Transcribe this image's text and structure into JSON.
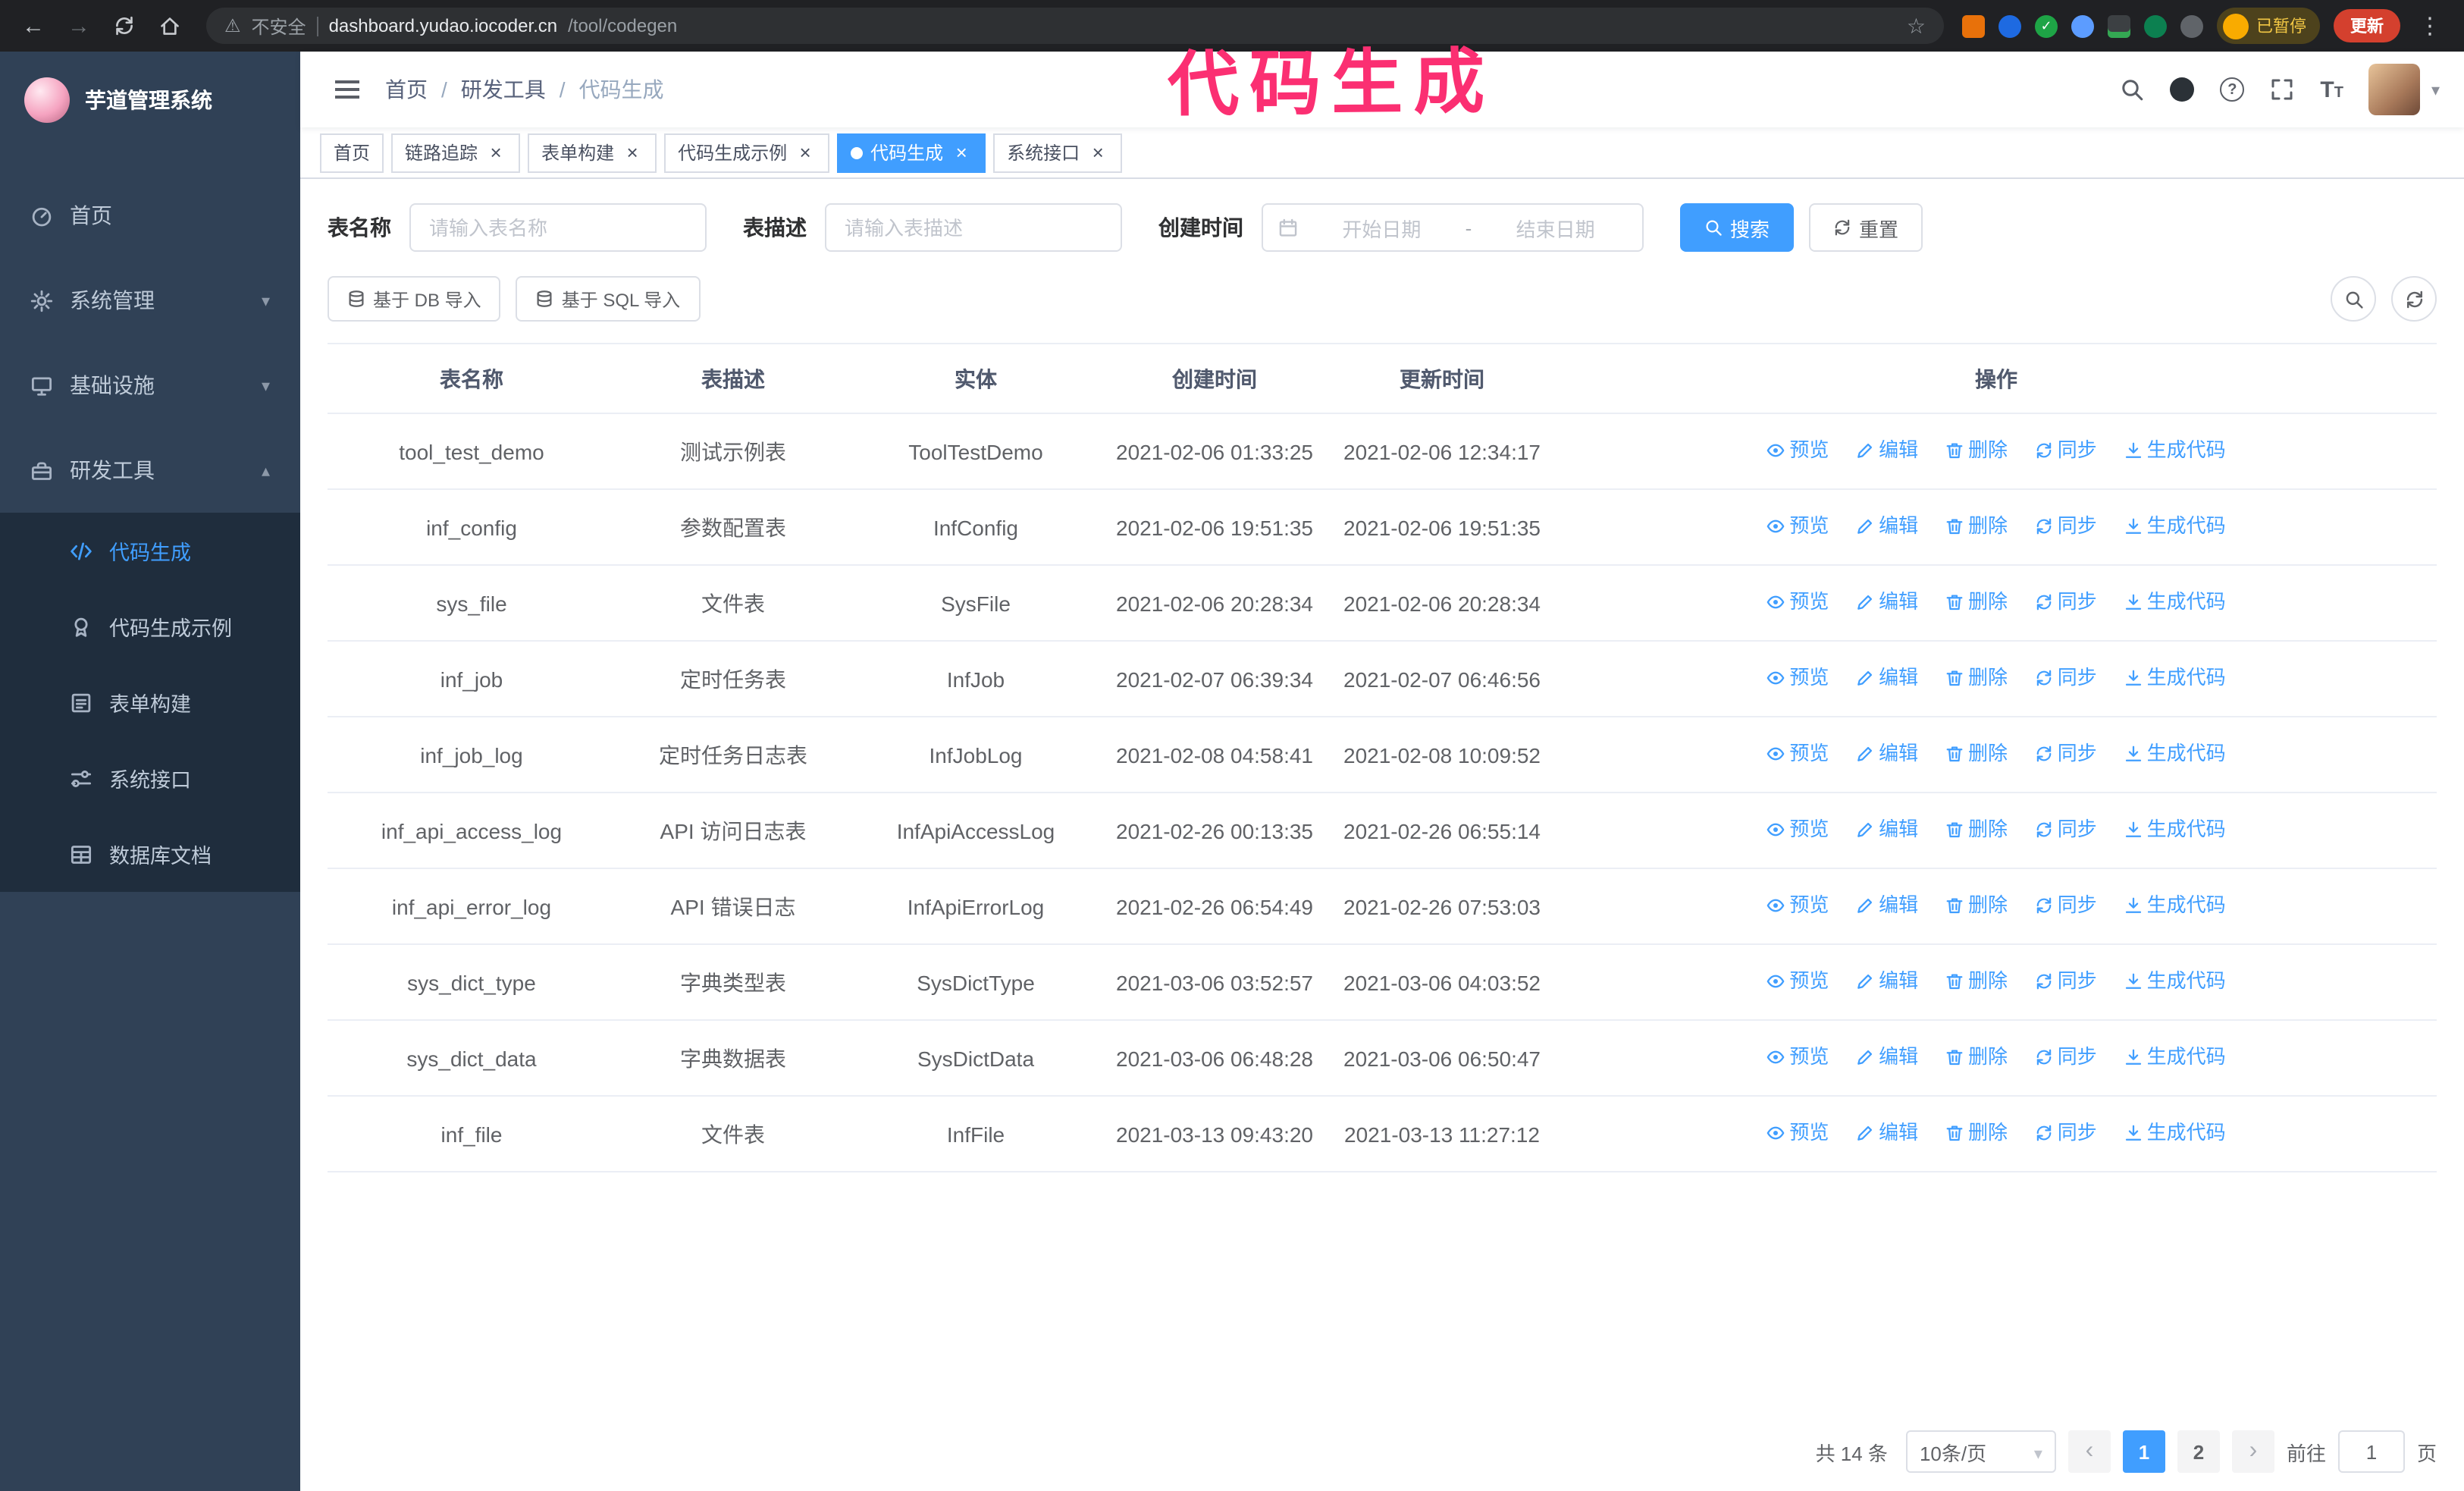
{
  "browser": {
    "security_label": "不安全",
    "url_host": "dashboard.yudao.iocoder.cn",
    "url_path": "/tool/codegen",
    "paused_badge": "已暂停",
    "update_button": "更新"
  },
  "annotation": {
    "text": "代码生成"
  },
  "sidebar": {
    "logo_title": "芋道管理系统",
    "items": [
      {
        "label": "首页"
      },
      {
        "label": "系统管理"
      },
      {
        "label": "基础设施"
      },
      {
        "label": "研发工具"
      }
    ],
    "submenu": [
      {
        "label": "代码生成",
        "active": true
      },
      {
        "label": "代码生成示例"
      },
      {
        "label": "表单构建"
      },
      {
        "label": "系统接口"
      },
      {
        "label": "数据库文档"
      }
    ]
  },
  "breadcrumb": {
    "separator": "/",
    "items": [
      "首页",
      "研发工具",
      "代码生成"
    ]
  },
  "tabs": [
    {
      "label": "首页",
      "closable": false
    },
    {
      "label": "链路追踪",
      "closable": true
    },
    {
      "label": "表单构建",
      "closable": true
    },
    {
      "label": "代码生成示例",
      "closable": true
    },
    {
      "label": "代码生成",
      "closable": true,
      "active": true
    },
    {
      "label": "系统接口",
      "closable": true
    }
  ],
  "filters": {
    "table_name_label": "表名称",
    "table_name_placeholder": "请输入表名称",
    "table_desc_label": "表描述",
    "table_desc_placeholder": "请输入表描述",
    "create_time_label": "创建时间",
    "start_date_placeholder": "开始日期",
    "range_separator": "-",
    "end_date_placeholder": "结束日期",
    "search_button": "搜索",
    "reset_button": "重置"
  },
  "toolbar": {
    "import_db_button": "基于 DB 导入",
    "import_sql_button": "基于 SQL 导入"
  },
  "table": {
    "columns": [
      "表名称",
      "表描述",
      "实体",
      "创建时间",
      "更新时间",
      "操作"
    ],
    "actions": [
      "预览",
      "编辑",
      "删除",
      "同步",
      "生成代码"
    ],
    "rows": [
      {
        "name": "tool_test_demo",
        "desc": "测试示例表",
        "entity": "ToolTestDemo",
        "created": "2021-02-06 01:33:25",
        "updated": "2021-02-06 12:34:17"
      },
      {
        "name": "inf_config",
        "desc": "参数配置表",
        "entity": "InfConfig",
        "created": "2021-02-06 19:51:35",
        "updated": "2021-02-06 19:51:35"
      },
      {
        "name": "sys_file",
        "desc": "文件表",
        "entity": "SysFile",
        "created": "2021-02-06 20:28:34",
        "updated": "2021-02-06 20:28:34"
      },
      {
        "name": "inf_job",
        "desc": "定时任务表",
        "entity": "InfJob",
        "created": "2021-02-07 06:39:34",
        "updated": "2021-02-07 06:46:56"
      },
      {
        "name": "inf_job_log",
        "desc": "定时任务日志表",
        "entity": "InfJobLog",
        "created": "2021-02-08 04:58:41",
        "updated": "2021-02-08 10:09:52"
      },
      {
        "name": "inf_api_access_log",
        "desc": "API 访问日志表",
        "entity": "InfApiAccessLog",
        "created": "2021-02-26 00:13:35",
        "updated": "2021-02-26 06:55:14"
      },
      {
        "name": "inf_api_error_log",
        "desc": "API 错误日志",
        "entity": "InfApiErrorLog",
        "created": "2021-02-26 06:54:49",
        "updated": "2021-02-26 07:53:03"
      },
      {
        "name": "sys_dict_type",
        "desc": "字典类型表",
        "entity": "SysDictType",
        "created": "2021-03-06 03:52:57",
        "updated": "2021-03-06 04:03:52"
      },
      {
        "name": "sys_dict_data",
        "desc": "字典数据表",
        "entity": "SysDictData",
        "created": "2021-03-06 06:48:28",
        "updated": "2021-03-06 06:50:47"
      },
      {
        "name": "inf_file",
        "desc": "文件表",
        "entity": "InfFile",
        "created": "2021-03-13 09:43:20",
        "updated": "2021-03-13 11:27:12"
      }
    ]
  },
  "pagination": {
    "total": "共 14 条",
    "page_size": "10条/页",
    "pages": [
      "1",
      "2"
    ],
    "active_page": "1",
    "goto_label": "前往",
    "goto_value": "1",
    "goto_unit": "页"
  },
  "colors": {
    "primary": "#409eff",
    "sidebar_bg": "#304156",
    "submenu_bg": "#1f2d3d",
    "annotation": "#fb2f72"
  }
}
